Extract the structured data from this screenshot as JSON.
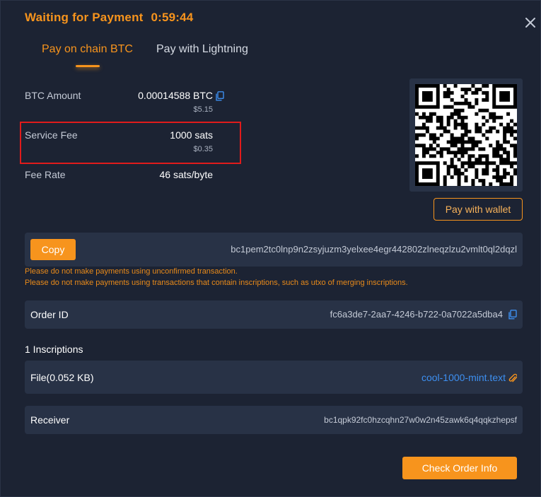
{
  "header": {
    "status": "Waiting for Payment",
    "timer": "0:59:44"
  },
  "tabs": [
    {
      "label": "Pay on chain BTC",
      "active": true
    },
    {
      "label": "Pay with Lightning",
      "active": false
    }
  ],
  "payment": {
    "btc_amount_label": "BTC Amount",
    "btc_amount_value": "0.00014588 BTC",
    "btc_amount_usd": "$5.15",
    "service_fee_label": "Service Fee",
    "service_fee_value": "1000 sats",
    "service_fee_usd": "$0.35",
    "fee_rate_label": "Fee Rate",
    "fee_rate_value": "46 sats/byte"
  },
  "wallet_button": "Pay with wallet",
  "address": {
    "copy_label": "Copy",
    "value": "bc1pem2tc0lnp9n2zsyjuzm3yelxee4egr442802zlneqzlzu2vmlt0ql2dqzl"
  },
  "warnings": [
    "Please do not make payments using unconfirmed transaction.",
    "Please do not make payments using transactions that contain inscriptions, such as utxo of merging inscriptions."
  ],
  "order": {
    "label": "Order ID",
    "value": "fc6a3de7-2aa7-4246-b722-0a7022a5dba4"
  },
  "inscriptions": {
    "heading": "1 Inscriptions",
    "file_label": "File(0.052 KB)",
    "file_name": "cool-1000-mint.text"
  },
  "receiver": {
    "label": "Receiver",
    "value": "bc1qpk92fc0hzcqhn27w0w2n45zawk6q4qqkzhepsf"
  },
  "check_button": "Check Order Info",
  "colors": {
    "accent": "#f7941d",
    "panel": "#283246",
    "background": "#1c2333",
    "link": "#3d8ff0",
    "highlight_border": "#e01b1b"
  }
}
